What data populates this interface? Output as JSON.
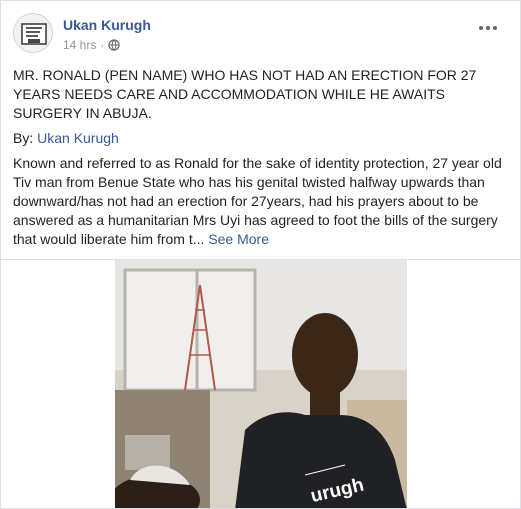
{
  "post": {
    "author": "Ukan Kurugh",
    "timestamp": "14 hrs",
    "separator": "·",
    "headline": "MR. RONALD (PEN NAME) WHO HAS NOT HAD AN ERECTION FOR 27 YEARS NEEDS CARE AND ACCOMMODATION WHILE HE AWAITS SURGERY IN ABUJA.",
    "by_label": "By:",
    "by_name": "Ukan Kurugh",
    "body": "Known and referred to as Ronald for the sake of identity protection, 27 year old Tiv man from Benue State who has his genital twisted halfway upwards than downward/has not had an erection for 27years, had his prayers about to be answered as a humanitarian Mrs Uyi has agreed to foot the bills of the surgery that would liberate him from t...",
    "see_more": "See More",
    "photo_shirt_text": "urugh"
  },
  "icons": {
    "privacy": "globe-icon",
    "menu": "more-options-icon"
  },
  "colors": {
    "link": "#385898",
    "text": "#1d2129",
    "meta": "#90949c",
    "background": "#e9ebee"
  }
}
